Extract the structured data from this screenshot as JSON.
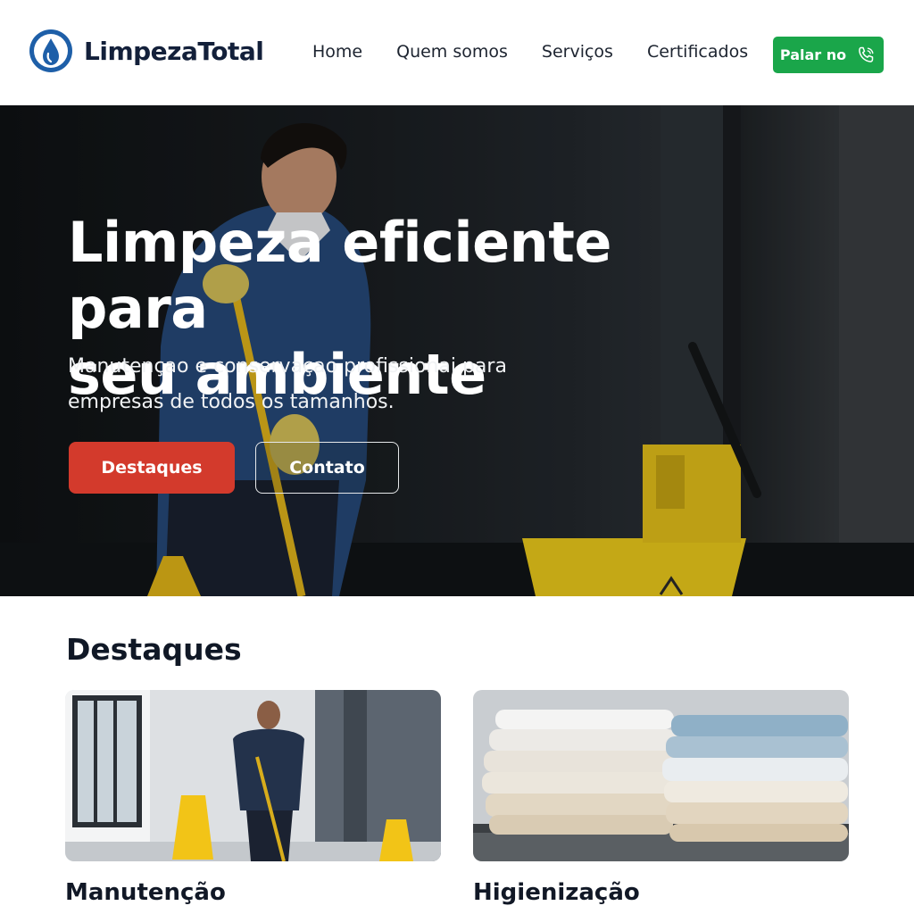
{
  "brand": {
    "name": "LimpezaTotal"
  },
  "nav": {
    "items": [
      {
        "label": "Home"
      },
      {
        "label": "Quem somos"
      },
      {
        "label": "Serviços"
      },
      {
        "label": "Certificados"
      }
    ],
    "cta_label": "Palar no"
  },
  "hero": {
    "title_line1": "Limpeza eficiente para",
    "title_line2": "seu ambiente",
    "subtitle_line1": "Manutençao e conservaçao profissionai para",
    "subtitle_line2": "empresas de todos os tamanhos.",
    "primary_button": "Destaques",
    "secondary_button": "Contato"
  },
  "highlights": {
    "title": "Destaques",
    "cards": [
      {
        "title": "Manutenção"
      },
      {
        "title": "Higienização"
      }
    ]
  },
  "colors": {
    "accent_green": "#1aa64a",
    "accent_red": "#d33a2c",
    "brand_blue": "#1e5fa8",
    "dark_text": "#13203a"
  },
  "icons": {
    "logo": "water-drop-logo-icon",
    "call": "phone-icon"
  }
}
